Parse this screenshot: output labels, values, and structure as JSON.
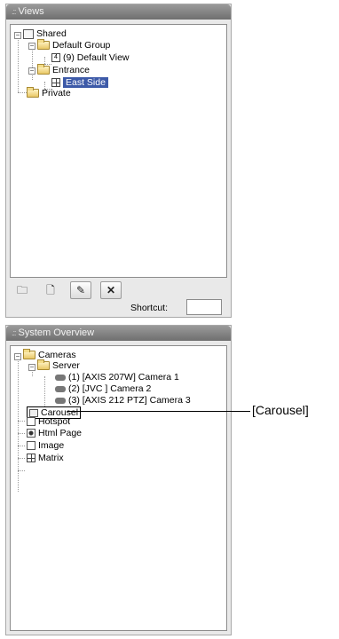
{
  "views_panel": {
    "title": "Views",
    "tree": {
      "shared": "Shared",
      "default_group": "Default Group",
      "default_view": "(9) Default View",
      "entrance": "Entrance",
      "east_side": "East Side",
      "private": "Private"
    },
    "shortcut_label": "Shortcut:",
    "shortcut_value": ""
  },
  "system_panel": {
    "title": "System Overview",
    "tree": {
      "cameras": "Cameras",
      "server": "Server",
      "camera1": "(1) [AXIS 207W] Camera 1",
      "camera2": "(2) [JVC ] Camera 2",
      "camera3": "(3) [AXIS 212 PTZ] Camera 3",
      "carousel": "Carousel",
      "hotspot": "Hotspot",
      "html_page": "Html Page",
      "image": "Image",
      "matrix": "Matrix"
    }
  },
  "callout": "[Carousel]"
}
